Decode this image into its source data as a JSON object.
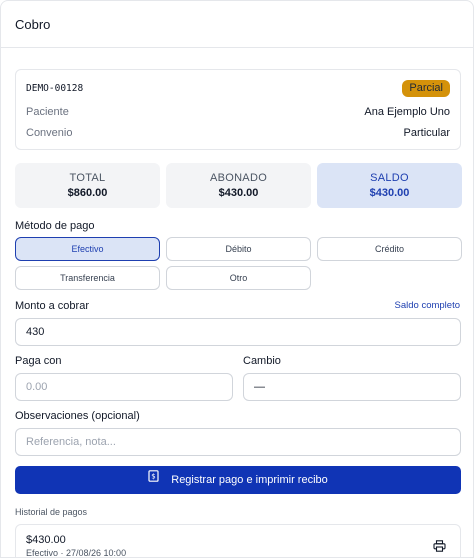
{
  "header": {
    "title": "Cobro"
  },
  "invoice": {
    "code": "DEMO-00128",
    "status_badge": "Parcial",
    "rows": [
      {
        "label": "Paciente",
        "value": "Ana Ejemplo Uno"
      },
      {
        "label": "Convenio",
        "value": "Particular"
      }
    ]
  },
  "totals": {
    "total": {
      "label": "TOTAL",
      "value": "$860.00"
    },
    "abonado": {
      "label": "ABONADO",
      "value": "$430.00"
    },
    "saldo": {
      "label": "SALDO",
      "value": "$430.00"
    }
  },
  "payment_method": {
    "label": "Método de pago",
    "selected": "Efectivo",
    "options": [
      "Efectivo",
      "Débito",
      "Crédito",
      "Transferencia",
      "Otro"
    ]
  },
  "amount": {
    "label": "Monto a cobrar",
    "full_balance_link": "Saldo completo",
    "value": "430"
  },
  "pays_with": {
    "label": "Paga con",
    "placeholder": "0.00"
  },
  "change": {
    "label": "Cambio",
    "value": "—"
  },
  "notes": {
    "label": "Observaciones (opcional)",
    "placeholder": "Referencia, nota..."
  },
  "submit": {
    "label": "Registrar pago e imprimir recibo",
    "icon": "receipt-icon"
  },
  "history": {
    "title": "Historial de pagos",
    "items": [
      {
        "amount": "$430.00",
        "meta": "Efectivo · 27/08/26 10:00",
        "icon": "printer-icon"
      }
    ]
  },
  "colors": {
    "primary": "#1034b5",
    "badge": "#d4920a",
    "saldo_bg": "#dbe4f6"
  }
}
